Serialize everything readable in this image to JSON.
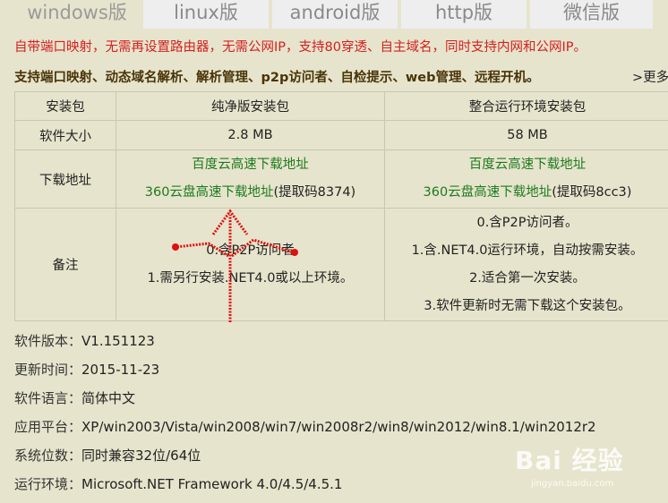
{
  "tabs": [
    "windows版",
    "linux版",
    "android版",
    "http版",
    "微信版"
  ],
  "intro": {
    "line1": "自带端口映射，无需再设置路由器，无需公网IP，支持80穿透、自主域名，同时支持内网和公网IP。",
    "line2": "支持端口映射、动态域名解析、解析管理、p2p访问者、自检提示、web管理、远程开机。",
    "more": ">更多"
  },
  "table": {
    "headers": [
      "安装包",
      "纯净版安装包",
      "整合运行环境安装包"
    ],
    "size_label": "软件大小",
    "size_values": [
      "2.8 MB",
      "58 MB"
    ],
    "download_label": "下载地址",
    "pure": {
      "baidu": "百度云高速下载地址",
      "pan360": "360云盘高速下载地址",
      "code": "(提取码8374)"
    },
    "full": {
      "baidu": "百度云高速下载地址",
      "pan360": "360云盘高速下载地址",
      "code": "(提取码8cc3)"
    },
    "notes_label": "备注",
    "pure_notes": [
      "0.含P2P访问者",
      "1.需另行安装.NET4.0或以上环境。"
    ],
    "full_notes": [
      "0.含P2P访问者。",
      "1.含.NET4.0运行环境，自动按需安装。",
      "2.适合第一次安装。",
      "3.软件更新时无需下载这个安装包。"
    ]
  },
  "info": [
    {
      "label": "软件版本：",
      "value": "V1.151123"
    },
    {
      "label": "更新时间：",
      "value": "2015-11-23"
    },
    {
      "label": "软件语言：",
      "value": "简体中文"
    },
    {
      "label": "应用平台：",
      "value": "XP/win2003/Vista/win2008/win7/win2008r2/win8/win2012/win8.1/win2012r2"
    },
    {
      "label": "系统位数：",
      "value": "同时兼容32位/64位"
    },
    {
      "label": "运行环境：",
      "value": "Microsoft.NET Framework 4.0/4.5/4.5.1"
    }
  ],
  "colors": {
    "annotation": "#e01010",
    "link": "#1e7a1e",
    "highlight": "#d42020"
  },
  "watermark": {
    "logo": "Bai  经验",
    "sub": "jingyan.baidu.com"
  }
}
